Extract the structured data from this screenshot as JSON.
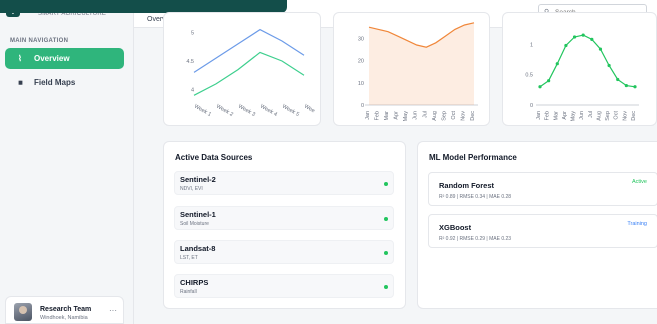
{
  "brand": {
    "logo_glyph": "◆",
    "subtitle": "SMART AGRICULTURE"
  },
  "header": {
    "title": "Overview"
  },
  "search": {
    "placeholder": "Search...",
    "value": ""
  },
  "nav": {
    "heading": "MAIN NAVIGATION",
    "items": [
      {
        "label": "Overview",
        "icon": "chart-line-icon",
        "glyph": "⌇",
        "active": true
      },
      {
        "label": "Field Maps",
        "icon": "bar-chart-icon",
        "glyph": "▮▮",
        "active": false
      }
    ]
  },
  "user": {
    "name": "Research Team",
    "location": "Windhoek, Namibia",
    "more": "···"
  },
  "chart_data": [
    {
      "type": "line",
      "categories": [
        "Week 1",
        "Week 2",
        "Week 3",
        "Week 4",
        "Week 5",
        "Wee"
      ],
      "series": [
        {
          "values": [
            4.3,
            4.55,
            4.8,
            5.05,
            4.85,
            4.6
          ],
          "color": "#6c9be8"
        },
        {
          "values": [
            3.9,
            4.1,
            4.35,
            4.65,
            4.5,
            4.25
          ],
          "color": "#3ecf8e"
        }
      ],
      "yticks": [
        "4",
        "4.5",
        "5"
      ],
      "ylim": [
        3.8,
        5.2
      ]
    },
    {
      "type": "area",
      "categories": [
        "Jan",
        "Feb",
        "Mar",
        "Apr",
        "May",
        "Jun",
        "Jul",
        "Aug",
        "Sep",
        "Oct",
        "Nov",
        "Dec"
      ],
      "values": [
        35,
        34,
        33,
        31,
        29,
        27,
        26,
        28,
        31,
        34,
        36,
        37
      ],
      "color": "#f0873a",
      "yticks": [
        "0",
        "10",
        "20",
        "30"
      ],
      "ylim": [
        0,
        36
      ]
    },
    {
      "type": "line",
      "categories": [
        "Jan",
        "Feb",
        "Mar",
        "Apr",
        "May",
        "Jun",
        "Jul",
        "Aug",
        "Sep",
        "Oct",
        "Nov",
        "Dec"
      ],
      "values": [
        0.3,
        0.4,
        0.68,
        0.98,
        1.12,
        1.15,
        1.08,
        0.92,
        0.65,
        0.42,
        0.32,
        0.3
      ],
      "color": "#22c55e",
      "yticks": [
        "0",
        "0.5",
        "1"
      ],
      "ylim": [
        0,
        1.35
      ]
    }
  ],
  "sources": {
    "title": "Active Data Sources",
    "items": [
      {
        "name": "Sentinel-2",
        "sub": "NDVI, EVI"
      },
      {
        "name": "Sentinel-1",
        "sub": "Soil Moisture"
      },
      {
        "name": "Landsat-8",
        "sub": "LST, ET"
      },
      {
        "name": "CHIRPS",
        "sub": "Rainfall"
      }
    ]
  },
  "models": {
    "title": "ML Model Performance",
    "items": [
      {
        "name": "Random Forest",
        "metrics": "R² 0.89 | RMSE 0.34 | MAE 0.28",
        "status": "Active",
        "status_color": "#22c55e"
      },
      {
        "name": "XGBoost",
        "metrics": "R² 0.92 | RMSE 0.29 | MAE 0.23",
        "status": "Training",
        "status_color": "#3b82f6"
      }
    ]
  }
}
